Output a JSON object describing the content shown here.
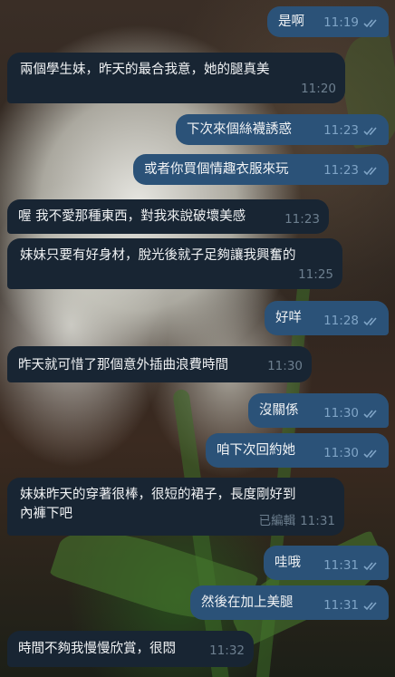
{
  "messages": [
    {
      "text": "是啊",
      "time": "11:19",
      "status": "read"
    },
    {
      "text": "兩個學生妹，昨天的最合我意，她的腿真美",
      "time": "11:20"
    },
    {
      "text": "下次來個絲襪誘惑",
      "time": "11:23",
      "status": "read"
    },
    {
      "text": "或者你買個情趣衣服來玩",
      "time": "11:23",
      "status": "read"
    },
    {
      "text": "喔 我不愛那種東西，對我來說破壞美感",
      "time": "11:23"
    },
    {
      "text": "妹妹只要有好身材，脫光後就子足夠讓我興奮的",
      "time": "11:25"
    },
    {
      "text": "好咩",
      "time": "11:28",
      "status": "read"
    },
    {
      "text": "昨天就可惜了那個意外插曲浪費時間",
      "time": "11:30"
    },
    {
      "text": "沒關係",
      "time": "11:30",
      "status": "read"
    },
    {
      "text": "咱下次回約她",
      "time": "11:30",
      "status": "read"
    },
    {
      "text_line1": "妹妹昨天的穿著很棒，很短的裙子，長度剛好到",
      "text_line2": "內褲下吧",
      "edited": "已編輯",
      "time": "11:31"
    },
    {
      "text": "哇哦",
      "time": "11:31",
      "status": "read"
    },
    {
      "text": "然後在加上美腿",
      "time": "11:31",
      "status": "read"
    },
    {
      "text": "時間不夠我慢慢欣賞，很悶",
      "time": "11:32"
    }
  ],
  "colors": {
    "outgoing": "#2b5278",
    "incoming": "#182533",
    "read_check": "#7fa4c6"
  }
}
